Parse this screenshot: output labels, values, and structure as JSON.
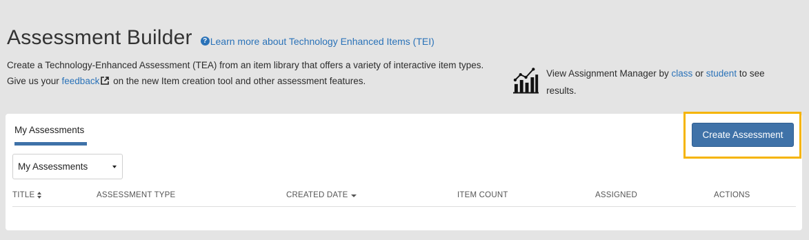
{
  "header": {
    "title": "Assessment Builder",
    "learn_link": "Learn more about Technology Enhanced Items (TEI)",
    "learn_icon": "question-circle-icon"
  },
  "description": {
    "line1": "Create a Technology-Enhanced Assessment (TEA) from an item library that offers a variety of interactive item types.",
    "line2_prefix": "Give us your ",
    "feedback_link": "feedback",
    "line2_suffix": " on the new Item creation tool and other assessment features."
  },
  "manager": {
    "text_prefix": "View Assignment Manager by ",
    "class_link": "class",
    "or_text": " or ",
    "student_link": "student",
    "text_suffix": " to see results."
  },
  "tabs": [
    {
      "label": "My Assessments",
      "active": true
    }
  ],
  "filter": {
    "selected": "My Assessments"
  },
  "create_button": "Create Assessment",
  "table": {
    "columns": [
      {
        "label": "TITLE",
        "sort": "both"
      },
      {
        "label": "ASSESSMENT TYPE",
        "sort": "none"
      },
      {
        "label": "CREATED DATE",
        "sort": "desc"
      },
      {
        "label": "ITEM COUNT",
        "sort": "none"
      },
      {
        "label": "ASSIGNED",
        "sort": "none"
      },
      {
        "label": "ACTIONS",
        "sort": "none"
      }
    ],
    "rows": []
  },
  "colors": {
    "accent": "#3f72a8",
    "link": "#2a72b8",
    "highlight": "#f5b400",
    "background": "#e4e4e4"
  }
}
